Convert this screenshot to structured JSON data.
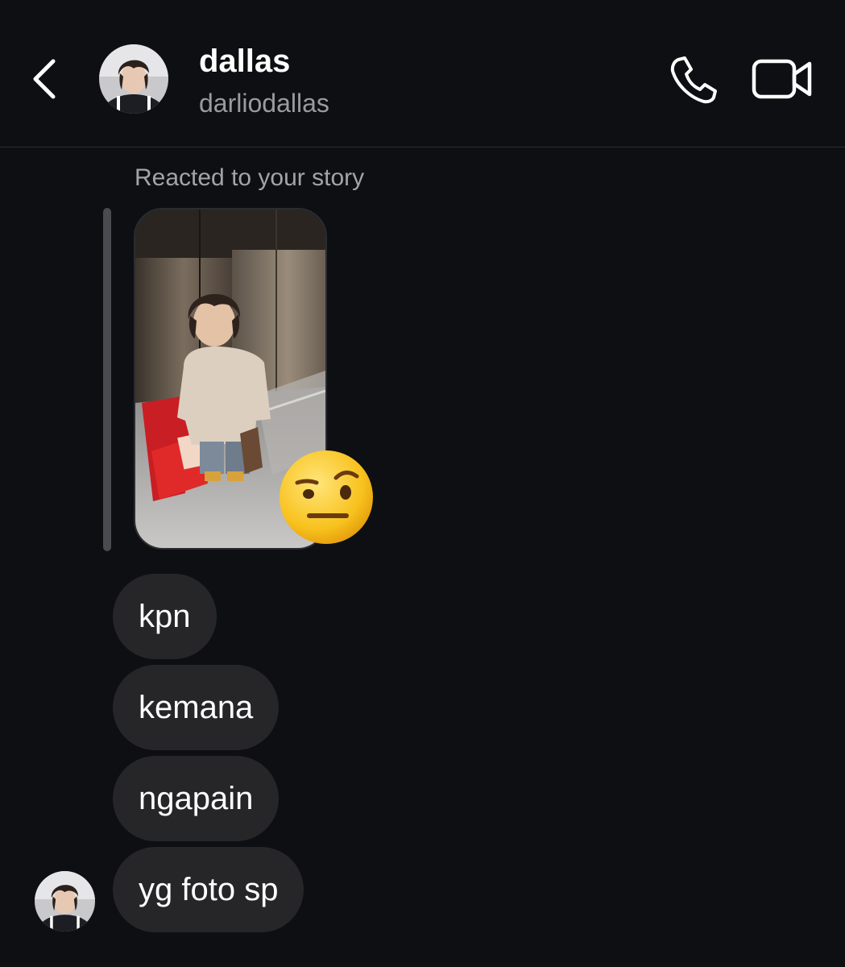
{
  "header": {
    "back_icon": "chevron-left-icon",
    "name": "dallas",
    "username": "darliodallas",
    "call_icon": "phone-icon",
    "video_icon": "video-camera-icon"
  },
  "story_reply": {
    "label": "Reacted to your story",
    "reaction_emoji": "face-with-raised-eyebrow"
  },
  "messages": [
    {
      "text": "kpn"
    },
    {
      "text": "kemana"
    },
    {
      "text": "ngapain"
    },
    {
      "text": "yg foto sp"
    }
  ],
  "colors": {
    "background": "#0e0f13",
    "bubble": "#262628",
    "secondary_text": "#9a9ba1",
    "divider": "#2a2b30"
  }
}
